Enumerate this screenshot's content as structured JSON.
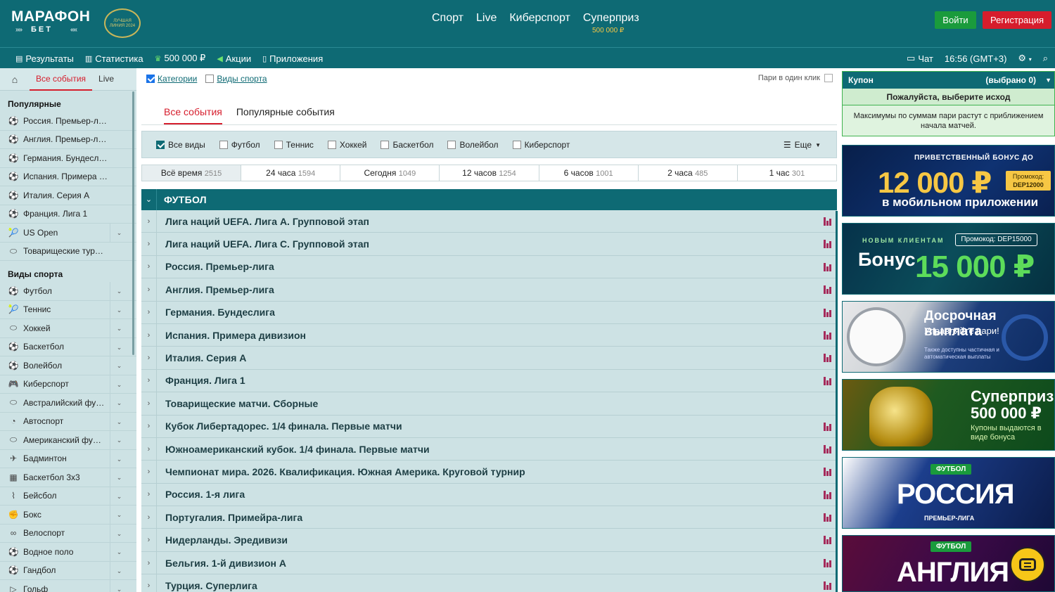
{
  "header": {
    "logo_main": "МАРАФОН",
    "logo_sub": "БЕТ",
    "award_text": "ЛУЧШАЯ ЛИНИЯ 2024",
    "nav": [
      "Спорт",
      "Live",
      "Киберспорт",
      "Суперприз"
    ],
    "superprize_sub": "500 000 ₽",
    "login_label": "Войти",
    "register_label": "Регистрация"
  },
  "subbar": {
    "items": [
      {
        "label": "Результаты",
        "icon": "results-icon"
      },
      {
        "label": "Статистика",
        "icon": "stats-icon"
      },
      {
        "label": "500 000 ₽",
        "icon": "prize-icon"
      },
      {
        "label": "Акции",
        "icon": "promo-icon"
      },
      {
        "label": "Приложения",
        "icon": "phone-icon"
      }
    ],
    "chat_label": "Чат",
    "time_label": "16:56 (GMT+3)"
  },
  "leftbar": {
    "tabs": [
      "Все события",
      "Live"
    ],
    "popular_header": "Популярные",
    "popular": [
      {
        "label": "Россия. Премьер-лига",
        "chevron": false
      },
      {
        "label": "Англия. Премьер-лига",
        "chevron": false
      },
      {
        "label": "Германия. Бундеслига",
        "chevron": false
      },
      {
        "label": "Испания. Примера див…",
        "chevron": false
      },
      {
        "label": "Италия. Серия А",
        "chevron": false
      },
      {
        "label": "Франция. Лига 1",
        "chevron": false
      },
      {
        "label": "US Open",
        "chevron": true
      },
      {
        "label": "Товарищеские турниры",
        "chevron": false
      }
    ],
    "sports_header": "Виды спорта",
    "sports": [
      "Футбол",
      "Теннис",
      "Хоккей",
      "Баскетбол",
      "Волейбол",
      "Киберспорт",
      "Австралийский фу…",
      "Автоспорт",
      "Американский фу…",
      "Бадминтон",
      "Баскетбол 3x3",
      "Бейсбол",
      "Бокс",
      "Велоспорт",
      "Водное поло",
      "Гандбол",
      "Гольф"
    ]
  },
  "filters": {
    "categories_label": "Категории",
    "sports_types_label": "Виды спорта",
    "oneclick_label": "Пари в один клик"
  },
  "event_tabs": [
    "Все события",
    "Популярные события"
  ],
  "sports_filter": {
    "items": [
      "Все виды",
      "Футбол",
      "Теннис",
      "Хоккей",
      "Баскетбол",
      "Волейбол",
      "Киберспорт"
    ],
    "more_label": "Еще"
  },
  "time_filter": [
    {
      "label": "Всё время",
      "count": "2515"
    },
    {
      "label": "24 часа",
      "count": "1594"
    },
    {
      "label": "Сегодня",
      "count": "1049"
    },
    {
      "label": "12 часов",
      "count": "1254"
    },
    {
      "label": "6 часов",
      "count": "1001"
    },
    {
      "label": "2 часа",
      "count": "485"
    },
    {
      "label": "1 час",
      "count": "301"
    }
  ],
  "sport_section": {
    "title": "ФУТБОЛ",
    "leagues": [
      {
        "name": "Лига наций UEFA. Лига A. Групповой этап",
        "stats": true
      },
      {
        "name": "Лига наций UEFA. Лига C. Групповой этап",
        "stats": true
      },
      {
        "name": "Россия. Премьер-лига",
        "stats": true
      },
      {
        "name": "Англия. Премьер-лига",
        "stats": true
      },
      {
        "name": "Германия. Бундеслига",
        "stats": true
      },
      {
        "name": "Испания. Примера дивизион",
        "stats": true
      },
      {
        "name": "Италия. Серия А",
        "stats": true
      },
      {
        "name": "Франция. Лига 1",
        "stats": true
      },
      {
        "name": "Товарищеские матчи. Сборные",
        "stats": false
      },
      {
        "name": "Кубок Либертадорес. 1/4 финала. Первые матчи",
        "stats": true
      },
      {
        "name": "Южноамериканский кубок. 1/4 финала. Первые матчи",
        "stats": true
      },
      {
        "name": "Чемпионат мира. 2026. Квалификация. Южная Америка. Круговой турнир",
        "stats": true
      },
      {
        "name": "Россия. 1-я лига",
        "stats": true
      },
      {
        "name": "Португалия. Примейра-лига",
        "stats": true
      },
      {
        "name": "Нидерланды. Эредивизи",
        "stats": true
      },
      {
        "name": "Бельгия. 1-й дивизион A",
        "stats": true
      },
      {
        "name": "Турция. Суперлига",
        "stats": true
      }
    ]
  },
  "coupon": {
    "title": "Купон",
    "selected": "(выбрано 0)",
    "pick_text": "Пожалуйста, выберите исход",
    "note": "Максимумы по суммам пари растут с приближением начала матчей."
  },
  "banners": {
    "b1": {
      "line1": "ПРИВЕТСТВЕННЫЙ БОНУС ДО",
      "amount": "12 000 ₽",
      "line3": "в мобильном приложении",
      "promo_label": "Промокод:",
      "promo_code": "DEP12000"
    },
    "b2": {
      "line1": "НОВЫМ КЛИЕНТАМ",
      "promo": "Промокод: DEP15000",
      "word": "Бонус",
      "amount": "15 000 ₽"
    },
    "b3": {
      "title": "Досрочная выплата",
      "subtitle": "Управляйте пари!",
      "note": "Также доступны частичная и автоматическая выплаты"
    },
    "b4": {
      "title": "Суперприз 500 000 ₽",
      "note": "Купоны выдаются в виде бонуса"
    },
    "b5": {
      "tag": "ФУТБОЛ",
      "title": "РОССИЯ",
      "subtitle": "ПРЕМЬЕР-ЛИГА"
    },
    "b6": {
      "tag": "ФУТБОЛ",
      "title": "АНГЛИЯ"
    }
  },
  "colors": {
    "brand": "#0e6a74",
    "accent_red": "#d61d2c",
    "accent_green": "#1a9b3c"
  }
}
